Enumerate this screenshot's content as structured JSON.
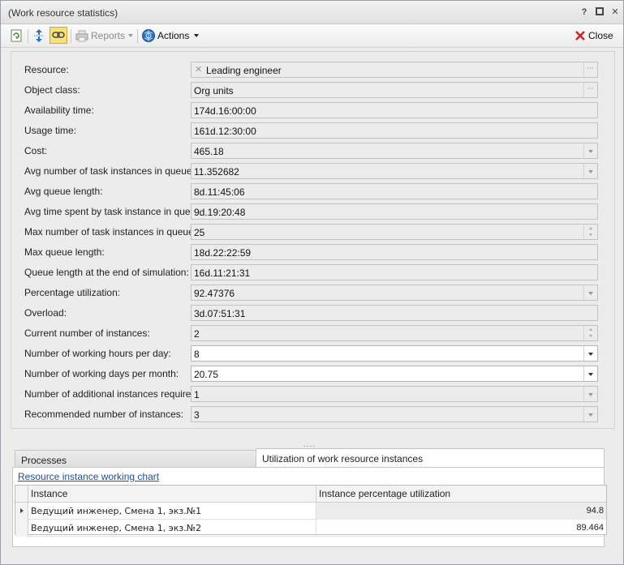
{
  "window": {
    "title": "(Work resource statistics)",
    "help_label": "?",
    "restore_label": "▫",
    "close_label": "✕"
  },
  "toolbar": {
    "reports_label": "Reports",
    "actions_label": "Actions",
    "close_label": "Close"
  },
  "form": {
    "fields": [
      {
        "label": "Resource:",
        "value": "Leading engineer"
      },
      {
        "label": "Object class:",
        "value": "Org units"
      },
      {
        "label": "Availability time:",
        "value": "174d.16:00:00"
      },
      {
        "label": "Usage time:",
        "value": "161d.12:30:00"
      },
      {
        "label": "Cost:",
        "value": "465.18"
      },
      {
        "label": "Avg number of task instances in queue:",
        "value": "11.352682"
      },
      {
        "label": "Avg queue length:",
        "value": "8d.11:45:06"
      },
      {
        "label": "Avg time spent by task instance in queue:",
        "value": "9d.19:20:48"
      },
      {
        "label": "Max number of task instances in queue:",
        "value": "25"
      },
      {
        "label": "Max queue length:",
        "value": "18d.22:22:59"
      },
      {
        "label": "Queue length at the end of simulation:",
        "value": "16d.11:21:31"
      },
      {
        "label": "Percentage utilization:",
        "value": "92.47376"
      },
      {
        "label": "Overload:",
        "value": "3d.07:51:31"
      },
      {
        "label": "Current number of instances:",
        "value": "2"
      },
      {
        "label": "Number of working hours per day:",
        "value": "8"
      },
      {
        "label": "Number of working days per month:",
        "value": "20.75"
      },
      {
        "label": "Number of additional instances required:",
        "value": "1"
      },
      {
        "label": "Recommended number of instances:",
        "value": "3"
      }
    ]
  },
  "splitter": "....",
  "tabs": {
    "processes": "Processes",
    "utilization": "Utilization of work resource instances"
  },
  "utilization_tab": {
    "chart_link": "Resource instance working chart",
    "columns": [
      "Instance",
      "Instance percentage utilization"
    ],
    "rows": [
      {
        "instance": "Ведущий инженер, Смена 1, экз.№1",
        "utilization": "94.8"
      },
      {
        "instance": "Ведущий инженер, Смена 1, экз.№2",
        "utilization": "89.464"
      }
    ]
  },
  "colors": {
    "accent_link": "#1f4e9a",
    "close_red": "#d42020",
    "actions_blue": "#2a6fc0"
  }
}
